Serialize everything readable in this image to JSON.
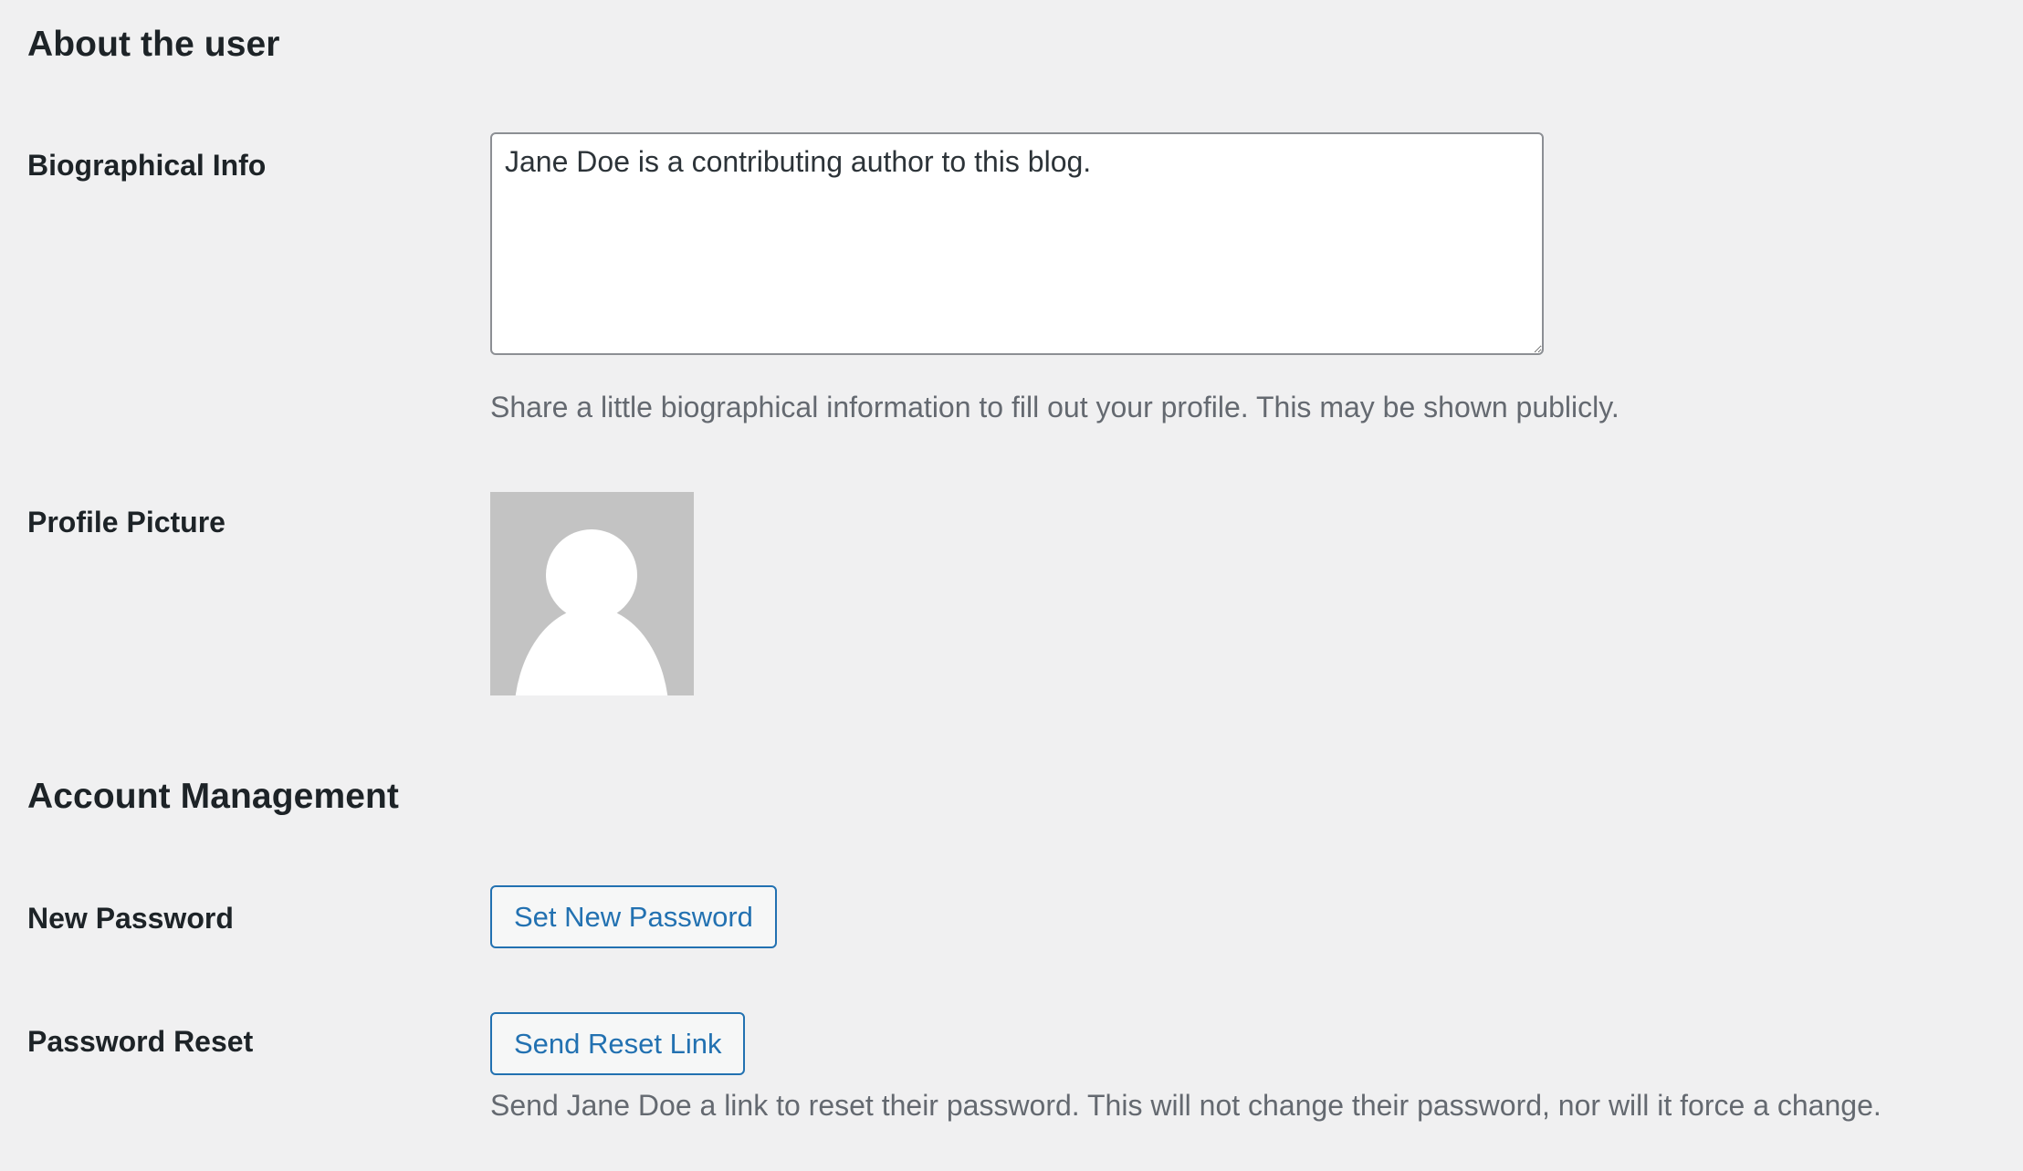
{
  "about_section": {
    "heading": "About the user",
    "bio": {
      "label": "Biographical Info",
      "value": "Jane Doe is a contributing author to this blog.",
      "description": "Share a little biographical information to fill out your profile. This may be shown publicly."
    },
    "profile_picture": {
      "label": "Profile Picture",
      "icon": "default-avatar-placeholder"
    }
  },
  "account_section": {
    "heading": "Account Management",
    "new_password": {
      "label": "New Password",
      "button_label": "Set New Password"
    },
    "password_reset": {
      "label": "Password Reset",
      "button_label": "Send Reset Link",
      "description": "Send Jane Doe a link to reset their password. This will not change their password, nor will it force a change."
    }
  },
  "colors": {
    "background": "#f0f0f1",
    "text": "#1d2327",
    "muted_text": "#646970",
    "accent": "#2271b1",
    "avatar_bg": "#c3c3c3"
  }
}
